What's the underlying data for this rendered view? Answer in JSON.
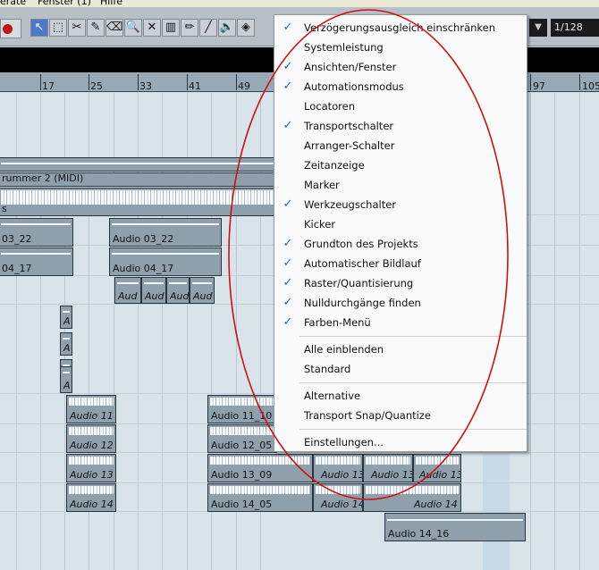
{
  "menubar": {
    "items": [
      "erate",
      "Fenster (1)",
      "Hilfe"
    ]
  },
  "toolbar": {
    "quantize_value": "1/128",
    "drop_arrow": "▼",
    "tools": [
      {
        "name": "object-selection-tool",
        "icon": "↖",
        "active": true
      },
      {
        "name": "range-selection-tool",
        "icon": "⬚"
      },
      {
        "name": "split-tool",
        "icon": "✂"
      },
      {
        "name": "draw-tool",
        "icon": "✎"
      },
      {
        "name": "erase-tool",
        "icon": "⌫"
      },
      {
        "name": "zoom-tool",
        "icon": "🔍"
      },
      {
        "name": "mute-tool",
        "icon": "✕"
      },
      {
        "name": "timewarp-tool",
        "icon": "▥"
      },
      {
        "name": "pencil-tool",
        "icon": "✏"
      },
      {
        "name": "line-tool",
        "icon": "╱"
      },
      {
        "name": "play-tool",
        "icon": "🔈"
      },
      {
        "name": "color-tool",
        "icon": "◈"
      }
    ]
  },
  "ruler": {
    "bars": [
      "17",
      "25",
      "33",
      "41",
      "49",
      "97",
      "105"
    ]
  },
  "parts": [
    {
      "label": "",
      "kind": "midi"
    },
    {
      "label": "rummer 2 (MIDI)",
      "kind": "midi"
    },
    {
      "label": "s",
      "kind": "audio"
    },
    {
      "label": "03_22",
      "kind": "audio"
    },
    {
      "label": "Audio 03_22",
      "kind": "audio"
    },
    {
      "label": "04_17",
      "kind": "audio"
    },
    {
      "label": "Audio 04_17",
      "kind": "audio"
    },
    {
      "label": "Aud",
      "kind": "small"
    },
    {
      "label": "Aud",
      "kind": "small"
    },
    {
      "label": "Aud",
      "kind": "small"
    },
    {
      "label": "Aud",
      "kind": "small"
    },
    {
      "label": "Audio 11",
      "kind": "audio"
    },
    {
      "label": "Audio 11_10",
      "kind": "audio"
    },
    {
      "label": "Audio 12",
      "kind": "audio"
    },
    {
      "label": "Audio 12_05",
      "kind": "audio"
    },
    {
      "label": "Audio 13",
      "kind": "audio"
    },
    {
      "label": "Audio 13_09",
      "kind": "audio"
    },
    {
      "label": "Audio 13",
      "kind": "audio"
    },
    {
      "label": "Audio 13",
      "kind": "audio"
    },
    {
      "label": "Audio 13",
      "kind": "audio"
    },
    {
      "label": "Audio 14",
      "kind": "audio"
    },
    {
      "label": "Audio 14_05",
      "kind": "audio"
    },
    {
      "label": "Audio 14",
      "kind": "audio"
    },
    {
      "label": "Audio 14",
      "kind": "audio"
    },
    {
      "label": "Audio 14_16",
      "kind": "audio"
    },
    {
      "label": "A",
      "kind": "small"
    },
    {
      "label": "A",
      "kind": "small"
    },
    {
      "label": "A",
      "kind": "small"
    },
    {
      "label": "A",
      "kind": "small"
    }
  ],
  "menu": {
    "check_glyph": "✓",
    "items": [
      {
        "label": "Verzögerungsausgleich einschränken",
        "checked": true
      },
      {
        "label": "Systemleistung",
        "checked": false
      },
      {
        "label": "Ansichten/Fenster",
        "checked": true
      },
      {
        "label": "Automationsmodus",
        "checked": true
      },
      {
        "label": "Locatoren",
        "checked": false
      },
      {
        "label": "Transportschalter",
        "checked": true
      },
      {
        "label": "Arranger-Schalter",
        "checked": false
      },
      {
        "label": "Zeitanzeige",
        "checked": false
      },
      {
        "label": "Marker",
        "checked": false
      },
      {
        "label": "Werkzeugschalter",
        "checked": true
      },
      {
        "label": "Kicker",
        "checked": false
      },
      {
        "label": "Grundton des Projekts",
        "checked": true
      },
      {
        "label": "Automatischer Bildlauf",
        "checked": true
      },
      {
        "label": "Raster/Quantisierung",
        "checked": true
      },
      {
        "label": "Nulldurchgänge finden",
        "checked": true
      },
      {
        "label": "Farben-Menü",
        "checked": true
      },
      {
        "label": "Alle einblenden",
        "checked": false
      },
      {
        "label": "Standard",
        "checked": false
      },
      {
        "label": "Alternative",
        "checked": false
      },
      {
        "label": "Transport  Snap/Quantize",
        "checked": false
      },
      {
        "label": "Einstellungen...",
        "checked": false
      }
    ]
  },
  "colors": {
    "annotation": "#d01010",
    "check": "#2561b8",
    "record": "#c31313"
  }
}
